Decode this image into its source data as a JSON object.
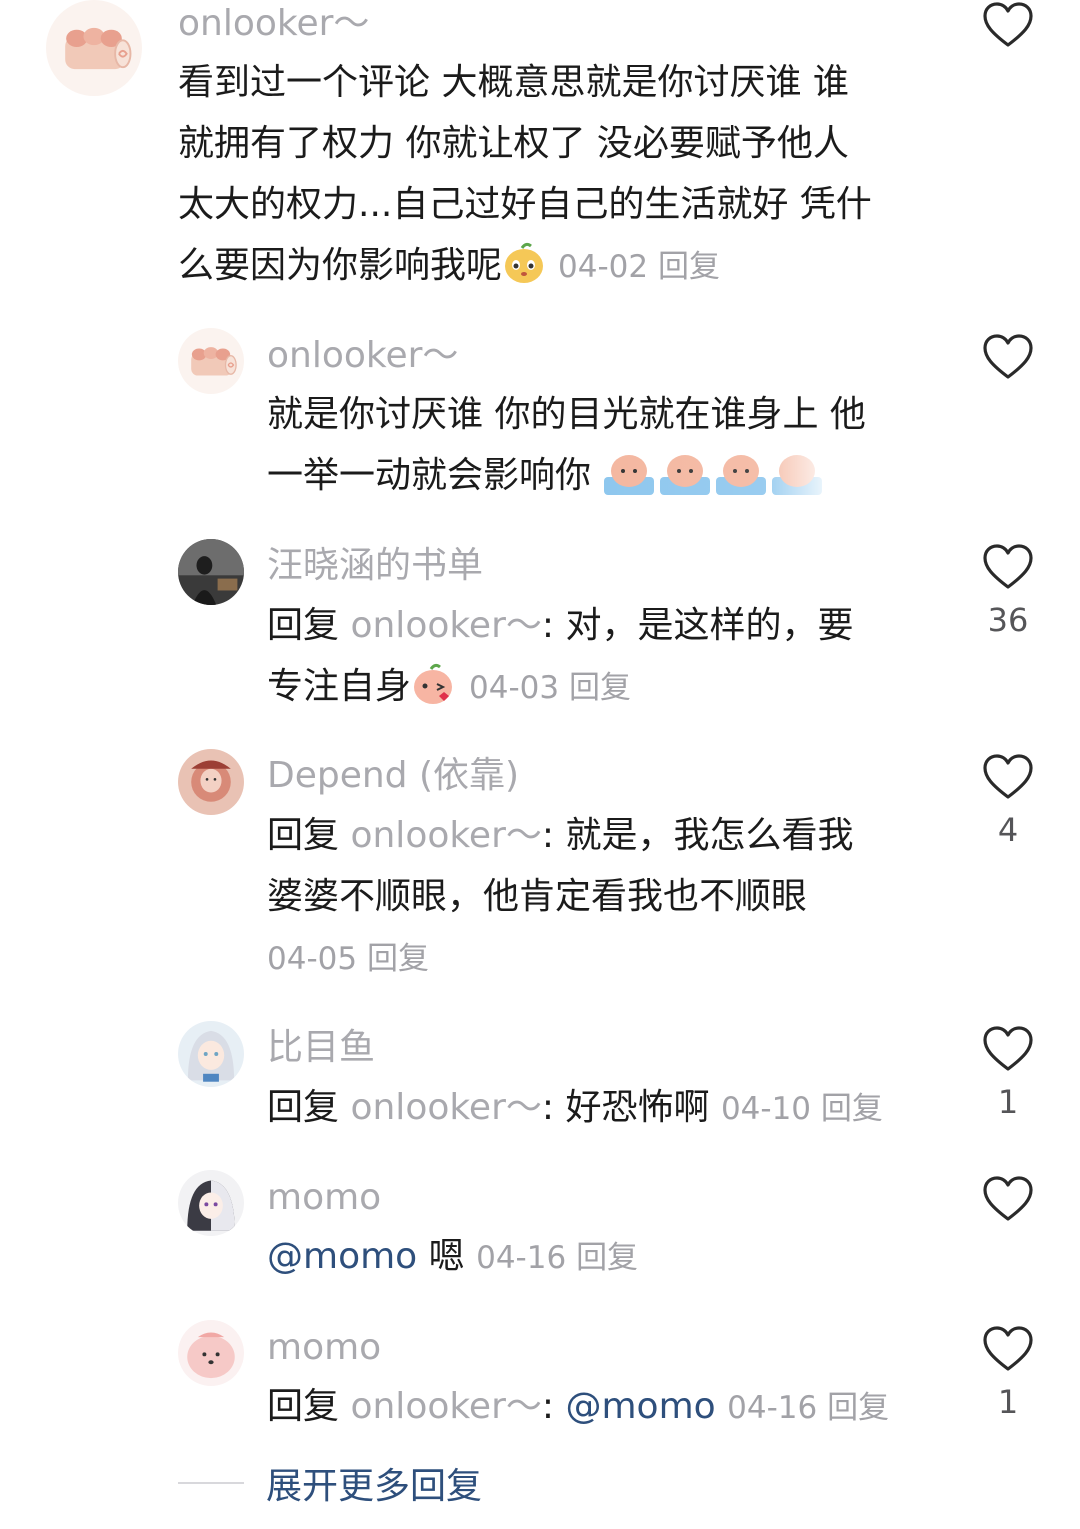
{
  "comments": {
    "main": {
      "username": "onlooker～",
      "text": "看到过一个评论 大概意思就是你讨厌谁 谁就拥有了权力 你就让权了 没必要赋予他人太大的权力...自己过好自己的生活就好 凭什么要因为你影响我呢",
      "line1": "看到过一个评论 大概意思就是你讨厌谁 谁",
      "line2": "就拥有了权力 你就让权了 没必要赋予他人",
      "line3": "太大的权力...自己过好自己的生活就好 凭什",
      "line4": "么要因为你影响我呢",
      "date": "04-02",
      "reply_label": "回复"
    },
    "reply1": {
      "username": "onlooker～",
      "line1": "就是你讨厌谁 你的目光就在谁身上 他",
      "line2": "一举一动就会影响你"
    },
    "reply2": {
      "username": "汪晓涵的书单",
      "reply_prefix": "回复",
      "mention": "onlooker～",
      "colon": ":",
      "line1_text": "对，是这样的，要",
      "line2_text": "专注自身",
      "date": "04-03",
      "reply_label": "回复",
      "likes": "36"
    },
    "reply3": {
      "username": "Depend (依靠)",
      "reply_prefix": "回复",
      "mention": "onlooker～",
      "colon": ":",
      "line1_text": "就是，我怎么看我",
      "line2_text": "婆婆不顺眼，他肯定看我也不顺眼",
      "date": "04-05",
      "reply_label": "回复",
      "likes": "4"
    },
    "reply4": {
      "username": "比目鱼",
      "reply_prefix": "回复",
      "mention": "onlooker～",
      "colon": ":",
      "line1_text": "好恐怖啊",
      "date": "04-10",
      "reply_label": "回复",
      "likes": "1"
    },
    "reply5": {
      "username": "momo",
      "at_mention": "@momo",
      "line1_text": "嗯",
      "date": "04-16",
      "reply_label": "回复"
    },
    "reply6": {
      "username": "momo",
      "reply_prefix": "回复",
      "mention": "onlooker～",
      "colon": ":",
      "at_mention": "@momo",
      "date": "04-16",
      "reply_label": "回复",
      "likes": "1"
    }
  },
  "expand_more": "展开更多回复",
  "icons": {
    "like": "heart-outline-icon",
    "emoji_smile": "peach-face-emoji",
    "emoji_kiss": "peach-kiss-emoji",
    "sticker": "peach-bath-sticker"
  },
  "colors": {
    "username": "#a9a9ae",
    "meta": "#a2a2a7",
    "link": "#2e4f7c",
    "text": "#1b1b1b"
  }
}
